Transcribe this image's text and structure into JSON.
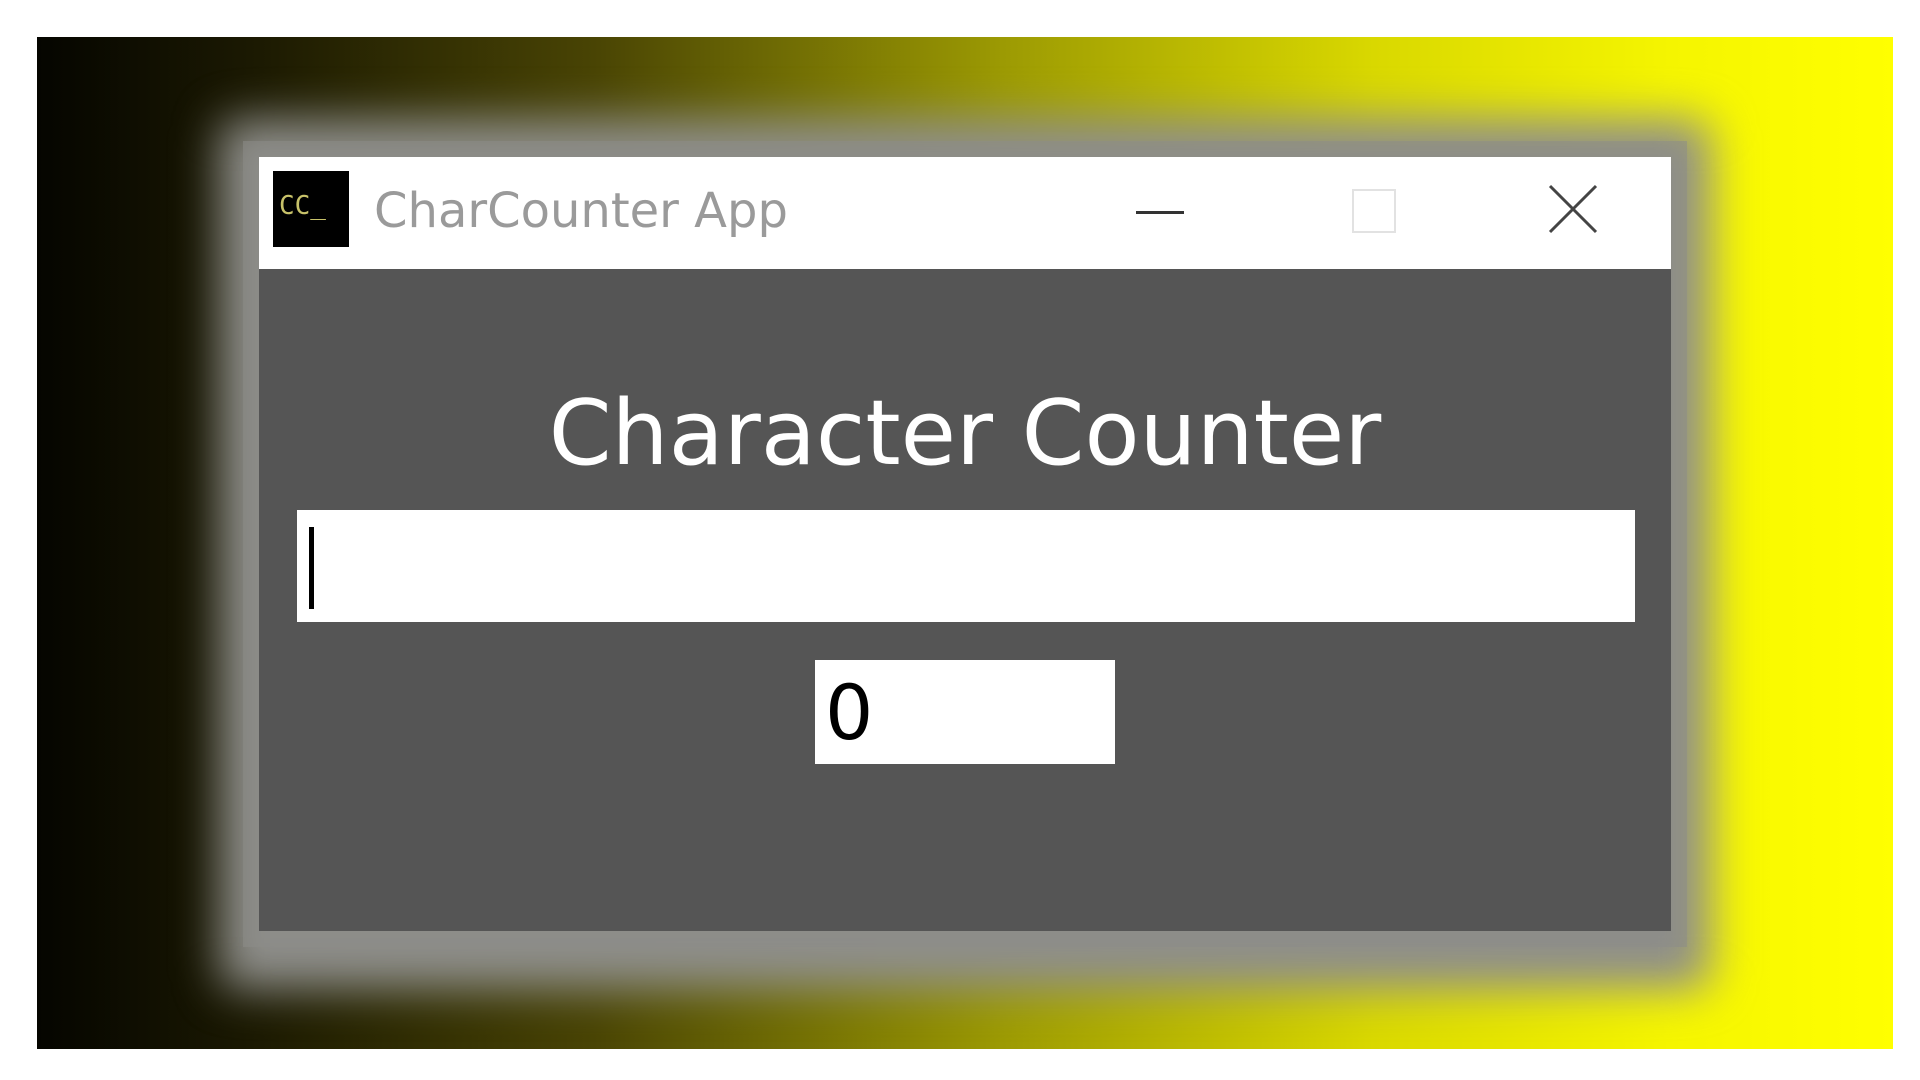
{
  "window": {
    "title": "CharCounter App",
    "app_icon_text": "CC_",
    "controls": {
      "minimize_icon": "minimize-icon",
      "maximize_icon": "maximize-icon",
      "close_icon": "close-icon"
    }
  },
  "main": {
    "heading": "Character Counter",
    "text_input": {
      "value": "",
      "placeholder": ""
    },
    "count_value": "0"
  },
  "colors": {
    "window_background": "#555555",
    "titlebar_background": "#ffffff",
    "heading_text": "#ffffff",
    "title_text": "#9a9a9a",
    "desktop_gradient_start": "#050500",
    "desktop_gradient_end": "#ffff00"
  }
}
